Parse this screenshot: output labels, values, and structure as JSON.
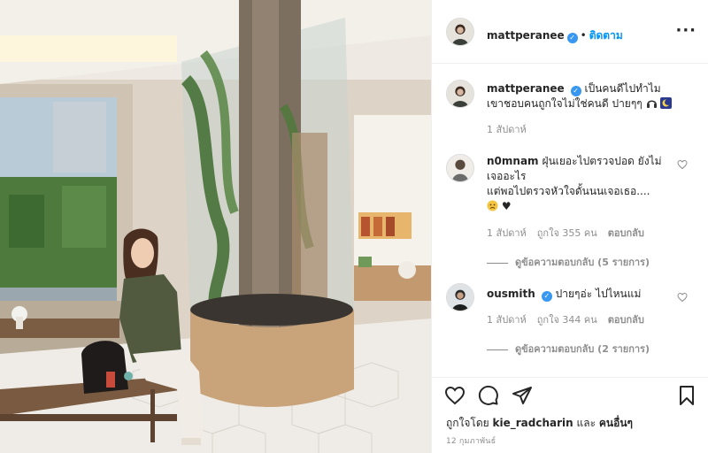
{
  "post": {
    "author": "mattperanee",
    "follow_label": "ติดตาม",
    "more_label": "···",
    "separator": "•"
  },
  "caption": {
    "username": "mattperanee",
    "text": "เป็นคนดีไปทำไม เขาชอบคนถูกใจไม่ใช่คนดี ปายๆๆ",
    "time": "1 สัปดาห์"
  },
  "comments": [
    {
      "username": "n0mnam",
      "text_line1": "ฝุ่นเยอะไปตรวจปอด ยังไม่เจออะไร",
      "text_line2": "แต่พอไปตรวจหัวใจดั้นนนเจอเธอ....",
      "time": "1 สัปดาห์",
      "likes": "ถูกใจ 355 คน",
      "reply_label": "ตอบกลับ",
      "view_replies": "ดูข้อความตอบกลับ (5 รายการ)"
    },
    {
      "username": "ousmith",
      "text_line1": "ปายๆอ่ะ ไปไหนแม่",
      "time": "1 สัปดาห์",
      "likes": "ถูกใจ 344 คน",
      "reply_label": "ตอบกลับ",
      "view_replies": "ดูข้อความตอบกลับ (2 รายการ)"
    }
  ],
  "footer": {
    "liked_prefix": "ถูกใจโดย",
    "liked_user": "kie_radcharin",
    "liked_and": "และ",
    "liked_others": "คนอื่นๆ",
    "date": "12 กุมภาพันธ์"
  },
  "icons": {
    "verified": "verified-badge-icon",
    "heart": "heart-icon",
    "comment": "comment-icon",
    "share": "send-icon",
    "save": "bookmark-icon"
  },
  "colors": {
    "verified_blue": "#3897f0",
    "follow_blue": "#0095f6",
    "meta_gray": "#8e8e8e"
  }
}
